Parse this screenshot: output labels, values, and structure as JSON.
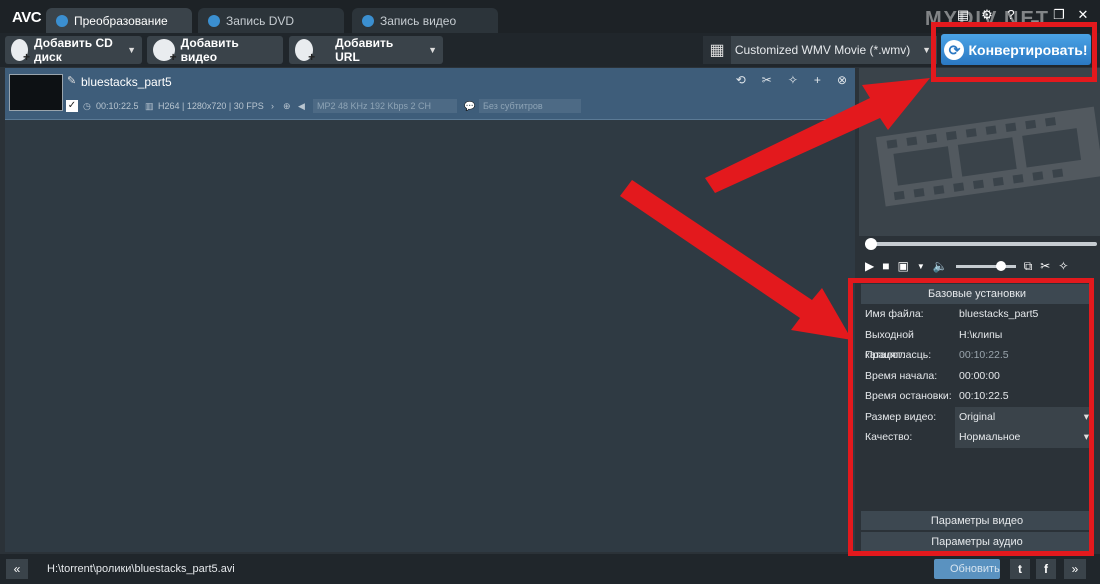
{
  "app": {
    "logo": "AVC",
    "watermark": "MYDIV.NET"
  },
  "tabs": [
    {
      "label": "Преобразование",
      "active": true
    },
    {
      "label": "Запись DVD",
      "active": false
    },
    {
      "label": "Запись видео",
      "active": false
    }
  ],
  "toolbar": {
    "add_cd": "Добавить CD диск",
    "add_video": "Добавить видео",
    "add_url": "Добавить URL",
    "profile": "Customized WMV Movie (*.wmv)",
    "convert": "Конвертировать!"
  },
  "file": {
    "name": "bluestacks_part5",
    "duration": "00:10:22.5",
    "video_info": "H264 | 1280x720 | 30 FPS",
    "audio": "MP2 48 KHz 192 Kbps 2 CH",
    "subtitles": "Без субтитров"
  },
  "settings": {
    "header": "Базовые установки",
    "rows": [
      {
        "label": "Имя файла:",
        "value": "bluestacks_part5"
      },
      {
        "label": "Выходной каталог:",
        "value": "H:\\клипы"
      },
      {
        "label": "Працягласць:",
        "value": "00:10:22.5"
      },
      {
        "label": "Время начала:",
        "value": "00:00:00"
      },
      {
        "label": "Время остановки:",
        "value": "00:10:22.5"
      },
      {
        "label": "Размер видео:",
        "value": "Original"
      },
      {
        "label": "Качество:",
        "value": "Нормальное"
      }
    ],
    "video_params": "Параметры видео",
    "audio_params": "Параметры аудио"
  },
  "status": {
    "path": "H:\\torrent\\ролики\\bluestacks_part5.avi",
    "update": "Обновить"
  },
  "colors": {
    "accent": "#3b8fd0",
    "annotation": "#e3191d",
    "selected_row": "#3e5d7a"
  }
}
